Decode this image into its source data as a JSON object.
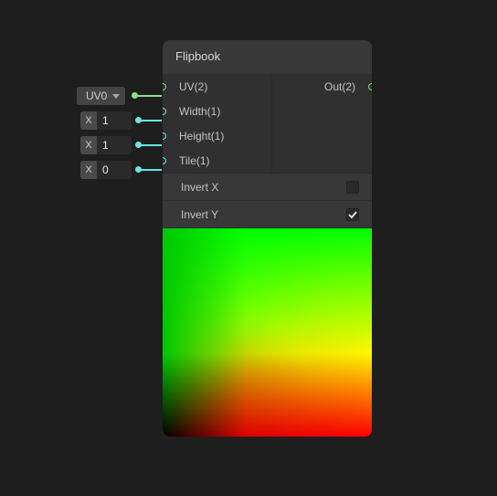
{
  "node": {
    "title": "Flipbook",
    "inputs": [
      {
        "label": "UV(2)",
        "color": "green"
      },
      {
        "label": "Width(1)",
        "color": "cyan"
      },
      {
        "label": "Height(1)",
        "color": "cyan"
      },
      {
        "label": "Tile(1)",
        "color": "cyan"
      }
    ],
    "outputs": [
      {
        "label": "Out(2)",
        "color": "green"
      }
    ],
    "options": {
      "invert_x": {
        "label": "Invert X",
        "checked": false
      },
      "invert_y": {
        "label": "Invert Y",
        "checked": true
      }
    }
  },
  "fields": {
    "uv_dropdown": {
      "value": "UV0"
    },
    "width": {
      "prefix": "X",
      "value": "1"
    },
    "height": {
      "prefix": "X",
      "value": "1"
    },
    "tile": {
      "prefix": "X",
      "value": "0"
    }
  }
}
